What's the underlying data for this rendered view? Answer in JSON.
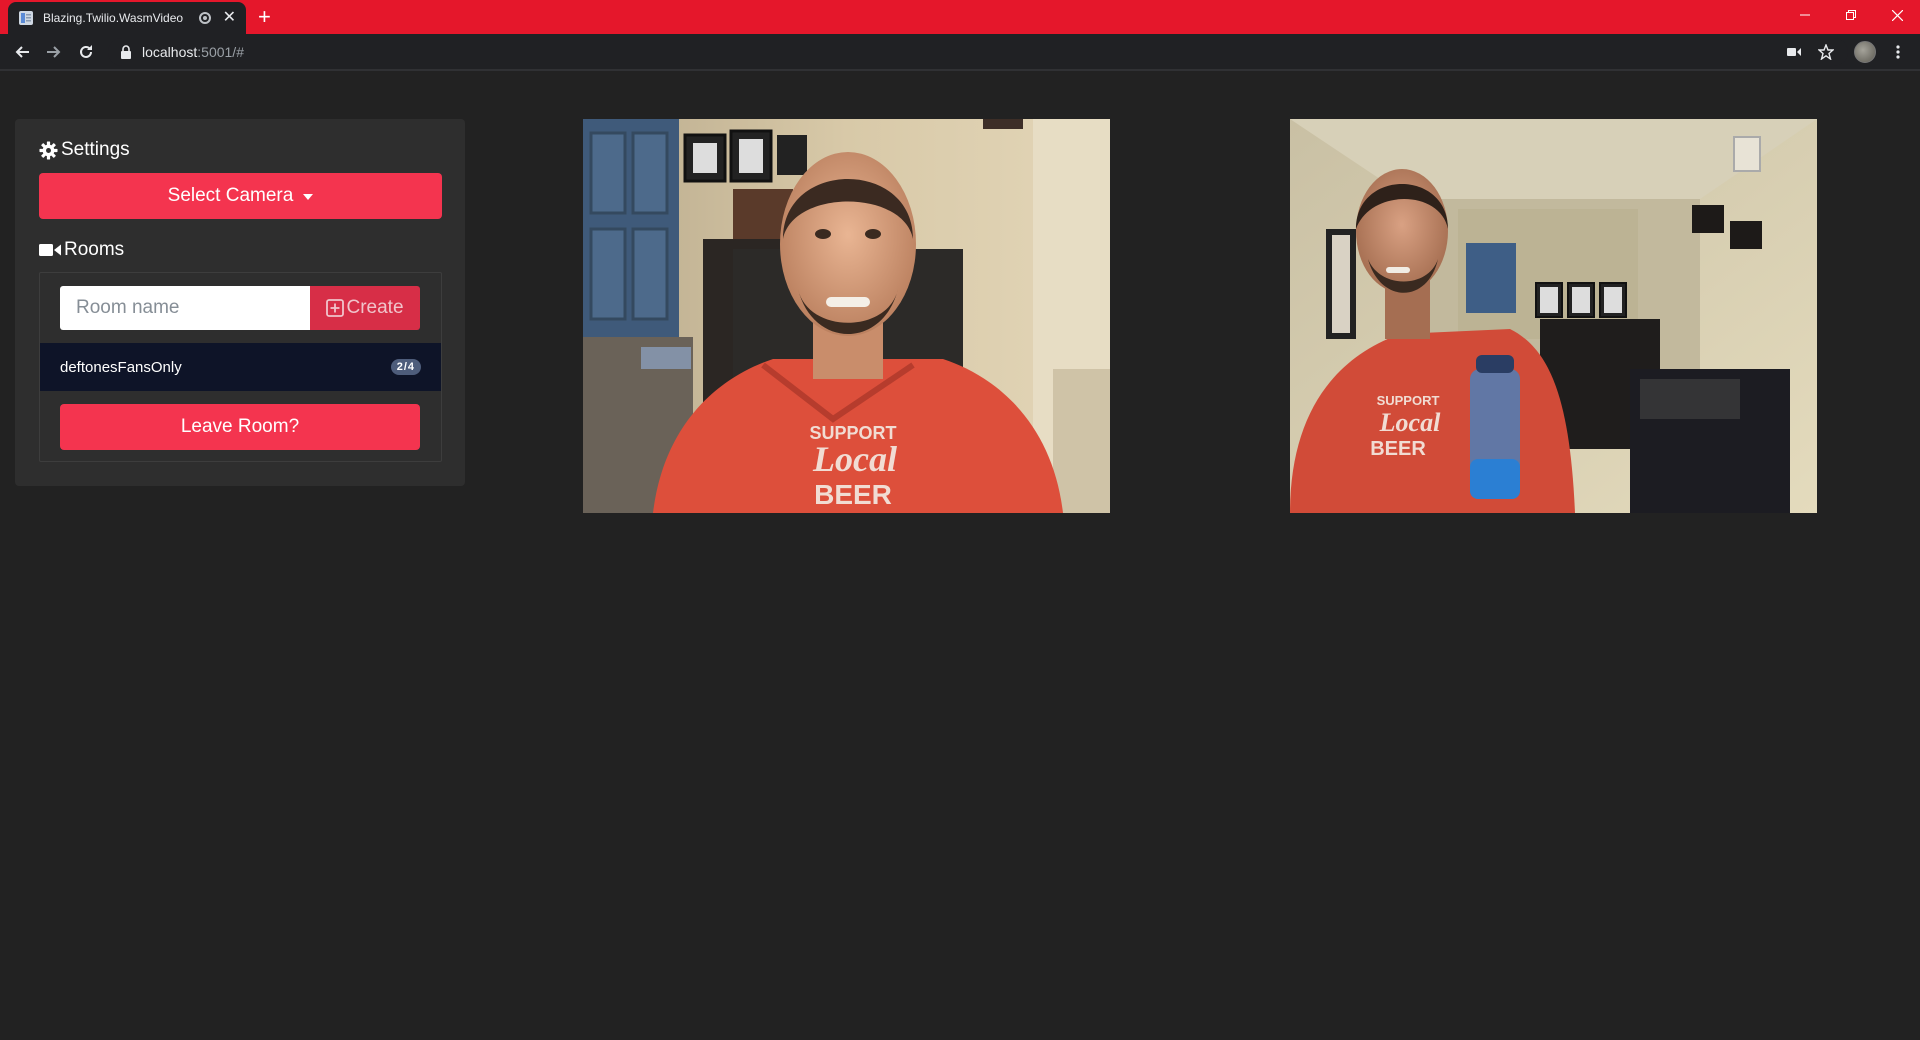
{
  "browser": {
    "tab_title": "Blazing.Twilio.WasmVideo",
    "url_host": "localhost",
    "url_path": ":5001/#",
    "icons": [
      "page-favicon-icon",
      "recording-icon",
      "close-icon",
      "plus-icon",
      "minimize-icon",
      "restore-icon",
      "window-close-icon",
      "back-arrow-icon",
      "forward-arrow-icon",
      "reload-icon",
      "lock-icon",
      "camera-icon",
      "star-icon",
      "kebab-menu-icon"
    ]
  },
  "sidebar": {
    "settings_title": "Settings",
    "select_camera_label": "Select Camera",
    "rooms_title": "Rooms",
    "room_input_placeholder": "Room name",
    "create_label": "Create",
    "rooms": [
      {
        "name": "deftonesFansOnly",
        "participants": "2/4"
      }
    ],
    "leave_label": "Leave Room?"
  },
  "videos": [
    {
      "id": "local",
      "shirt_lines": [
        "SUPPORT",
        "Local",
        "BEER"
      ]
    },
    {
      "id": "remote",
      "shirt_lines": [
        "SUPPORT",
        "Local",
        "BEER"
      ]
    }
  ],
  "colors": {
    "accent": "#f4344f",
    "titlebar": "#e5172b",
    "background": "#222222",
    "panel": "#2e2e2e",
    "room_row": "#0e1428"
  }
}
